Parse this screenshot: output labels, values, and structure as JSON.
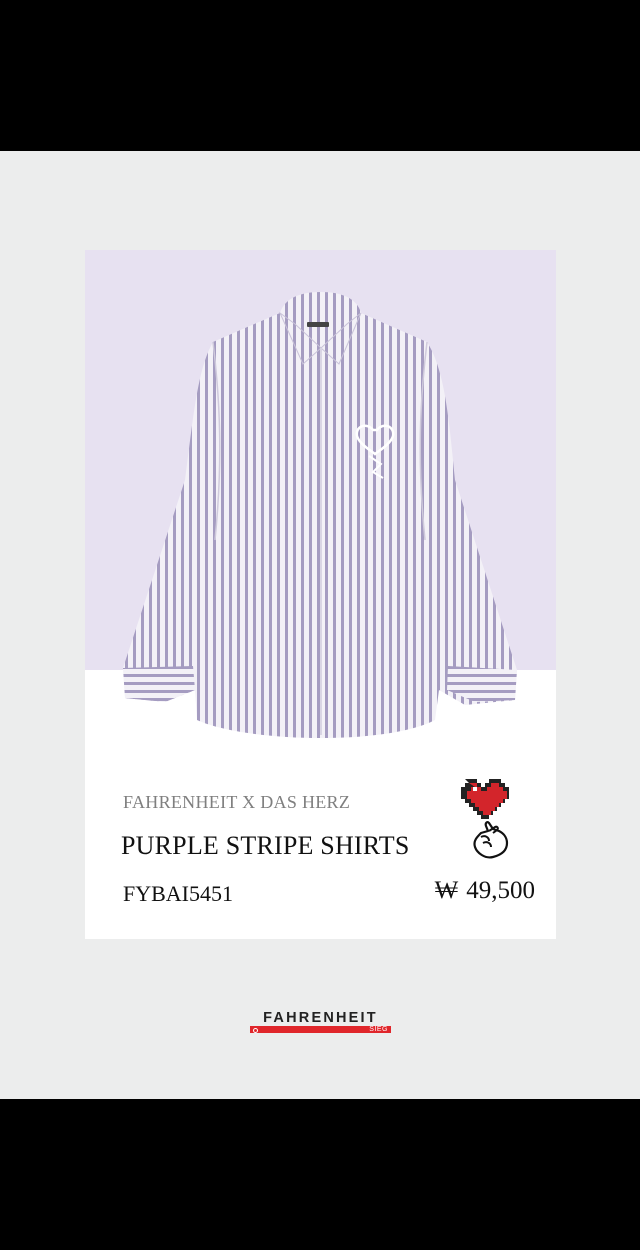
{
  "product": {
    "collection": "FAHRENHEIT X DAS HERZ",
    "name": "PURPLE STRIPE SHIRTS",
    "code": "FYBAI5451",
    "currency_symbol": "₩",
    "price": "49,500",
    "image_icon": "shirt-image",
    "badge_icon": "heart-finger-icon"
  },
  "footer": {
    "logo_word": "FAHRENHEIT",
    "logo_sub": "SIEG"
  },
  "colors": {
    "accent": "#e0262b",
    "card_bg": "#e7e1f1",
    "page_bg": "#eceded"
  }
}
